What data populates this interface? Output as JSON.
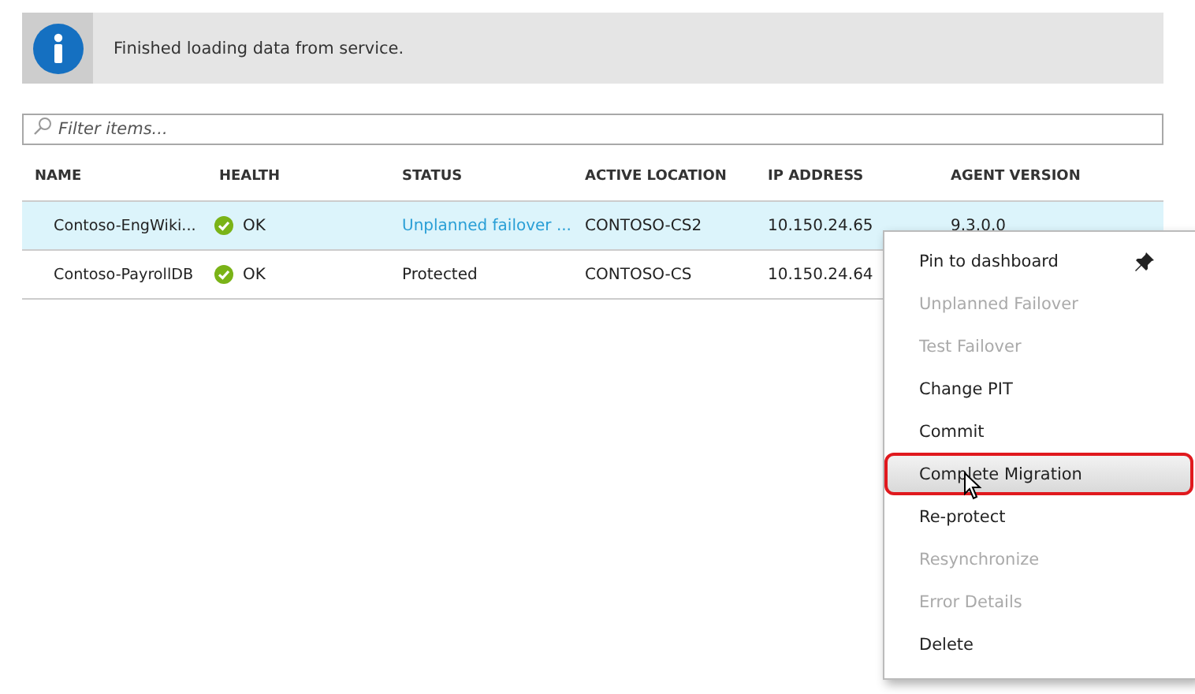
{
  "notification": {
    "message": "Finished loading data from service."
  },
  "filter": {
    "placeholder": "Filter items..."
  },
  "table": {
    "columns": [
      "NAME",
      "HEALTH",
      "STATUS",
      "ACTIVE LOCATION",
      "IP ADDRESS",
      "AGENT VERSION"
    ],
    "rows": [
      {
        "selected": true,
        "name": "Contoso-EngWiki...",
        "health": "OK",
        "status": "Unplanned failover ...",
        "status_link": true,
        "location": "CONTOSO-CS2",
        "ip": "10.150.24.65",
        "agent": "9.3.0.0"
      },
      {
        "selected": false,
        "name": "Contoso-PayrollDB",
        "health": "OK",
        "status": "Protected",
        "status_link": false,
        "location": "CONTOSO-CS",
        "ip": "10.150.24.64"
      }
    ]
  },
  "context_menu": {
    "items": [
      {
        "label": "Pin to dashboard",
        "kind": "pin",
        "disabled": false,
        "selected": false
      },
      {
        "label": "Unplanned Failover",
        "kind": "plain",
        "disabled": true,
        "selected": false
      },
      {
        "label": "Test Failover",
        "kind": "plain",
        "disabled": true,
        "selected": false
      },
      {
        "label": "Change PIT",
        "kind": "plain",
        "disabled": false,
        "selected": false
      },
      {
        "label": "Commit",
        "kind": "plain",
        "disabled": false,
        "selected": false
      },
      {
        "label": "Complete Migration",
        "kind": "plain",
        "disabled": false,
        "selected": true
      },
      {
        "label": "Re-protect",
        "kind": "plain",
        "disabled": false,
        "selected": false
      },
      {
        "label": "Resynchronize",
        "kind": "plain",
        "disabled": true,
        "selected": false
      },
      {
        "label": "Error Details",
        "kind": "plain",
        "disabled": true,
        "selected": false
      },
      {
        "label": "Delete",
        "kind": "plain",
        "disabled": false,
        "selected": false
      }
    ]
  }
}
